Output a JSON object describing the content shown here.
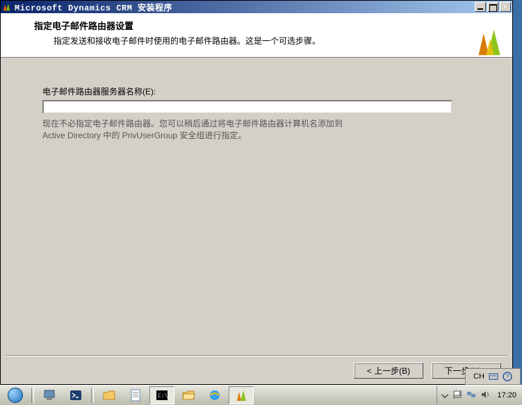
{
  "window": {
    "title": "Microsoft Dynamics CRM 安装程序"
  },
  "header": {
    "title": "指定电子邮件路由器设置",
    "subtitle": "指定发送和接收电子邮件时使用的电子邮件路由器。这是一个可选步骤。"
  },
  "form": {
    "router_label": "电子邮件路由器服务器名称(E):",
    "router_value": "",
    "help_line1": "现在不必指定电子邮件路由器。您可以稍后通过将电子邮件路由器计算机名添加到",
    "help_line2": "Active Directory 中的 PrivUserGroup 安全组进行指定。"
  },
  "buttons": {
    "back": "< 上一步(B)",
    "next": "下一步(N) >"
  },
  "langbar": {
    "ime": "CH"
  },
  "tray": {
    "time": "17:20"
  }
}
